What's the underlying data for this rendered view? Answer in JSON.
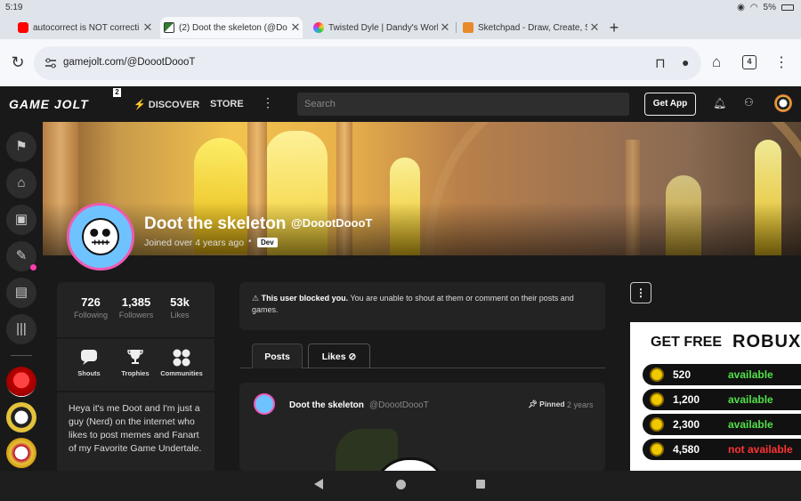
{
  "status": {
    "time": "5:19",
    "battery": "5%"
  },
  "tabs": [
    {
      "title": "autocorrect is NOT correcti",
      "fav_color": "#ff0000"
    },
    {
      "title": "(2) Doot the skeleton (@Do",
      "fav_color": "#2f7f2f"
    },
    {
      "title": "Twisted Dyle | Dandy's Worl",
      "fav_color": "#7ac843"
    },
    {
      "title": "Sketchpad - Draw, Create, Sh",
      "fav_color": "#e88a2a"
    }
  ],
  "browser": {
    "url": "gamejolt.com/@DoootDoooT",
    "tab_count": "4"
  },
  "gj": {
    "logo": "GAME JOLT",
    "logo_badge": "2",
    "discover": "DISCOVER",
    "store": "STORE",
    "search_placeholder": "Search",
    "get_app": "Get App"
  },
  "profile": {
    "name": "Doot the skeleton",
    "handle": "@DoootDoooT",
    "joined": "Joined over 4 years ago",
    "dot": "•",
    "badge": "Dev",
    "stats": [
      {
        "num": "726",
        "label": "Following"
      },
      {
        "num": "1,385",
        "label": "Followers"
      },
      {
        "num": "53k",
        "label": "Likes"
      }
    ],
    "links": [
      {
        "label": "Shouts",
        "icon": "speech-bubble-icon"
      },
      {
        "label": "Trophies",
        "icon": "trophy-icon"
      },
      {
        "label": "Communities",
        "icon": "communities-icon"
      }
    ],
    "bio": "Heya it's me Doot and I'm just a guy (Nerd) on the internet who likes to post memes and Fanart of my Favorite Game Undertale."
  },
  "blocked": {
    "bold": "This user blocked you.",
    "rest": " You are unable to shout at them or comment on their posts and games."
  },
  "post_tabs": {
    "posts": "Posts",
    "likes": "Likes"
  },
  "post": {
    "author": "Doot the skeleton",
    "handle": "@DoootDoooT",
    "pinned": "Pinned",
    "time": "2 years"
  },
  "ad": {
    "title": "GET FREE",
    "brand": "ROBUX",
    "rows": [
      {
        "amount": "520",
        "status": "available",
        "available": true
      },
      {
        "amount": "1,200",
        "status": "available",
        "available": true
      },
      {
        "amount": "2,300",
        "status": "available",
        "available": true
      },
      {
        "amount": "4,580",
        "status": "not available",
        "available": false
      }
    ]
  }
}
